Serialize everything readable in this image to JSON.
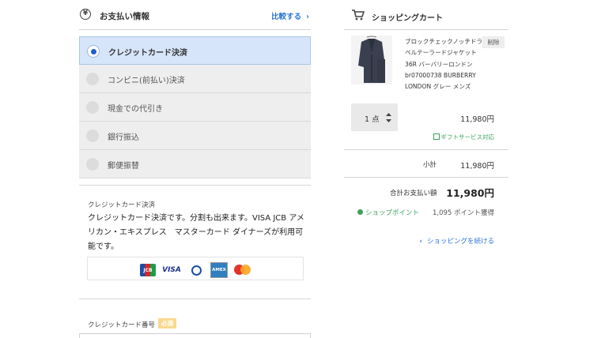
{
  "payment": {
    "icon": "yen-icon",
    "title": "お支払い情報",
    "compare_link": "比較する",
    "methods": [
      {
        "label": "クレジットカード決済",
        "selected": true
      },
      {
        "label": "コンビニ(前払い)決済",
        "selected": false
      },
      {
        "label": "現金での代引き",
        "selected": false
      },
      {
        "label": "銀行振込",
        "selected": false
      },
      {
        "label": "郵便振替",
        "selected": false
      }
    ],
    "credit_section": {
      "title": "クレジットカード決済",
      "description": "クレジットカード決済です。分割も出来ます。VISA JCB アメリカン・エキスプレス　マスターカード ダイナーズが利用可能です。",
      "brands": {
        "jcb": "JCB",
        "visa": "VISA",
        "diners": "Diners Club",
        "amex": "AMERICAN EXPRESS",
        "master": "MasterCard"
      }
    },
    "card_number": {
      "label": "クレジットカード番号",
      "required": "必須"
    }
  },
  "cart": {
    "icon": "cart-icon",
    "title": "ショッピングカート",
    "item": {
      "name": "ブロックチェックノッチドラベルテーラードジャケット　36R バーバリーロンドン br07000738 BURBERRY LONDON グレー メンズ",
      "delete_label": "削除",
      "quantity": "1 点",
      "price": "11,980円",
      "gift": "ギフトサービス対応"
    },
    "subtotal_label": "小計",
    "subtotal_value": "11,980円",
    "total_label": "合計お支払い額",
    "total_value": "11,980円",
    "points_label": "ショップポイント",
    "points_value": "1,095 ポイント獲得",
    "continue_link": "ショッピングを続ける"
  },
  "colors": {
    "accent": "#2a74d4",
    "selected_bg": "#d6e5f9",
    "green": "#3aa35a",
    "required": "#f9d98c"
  }
}
